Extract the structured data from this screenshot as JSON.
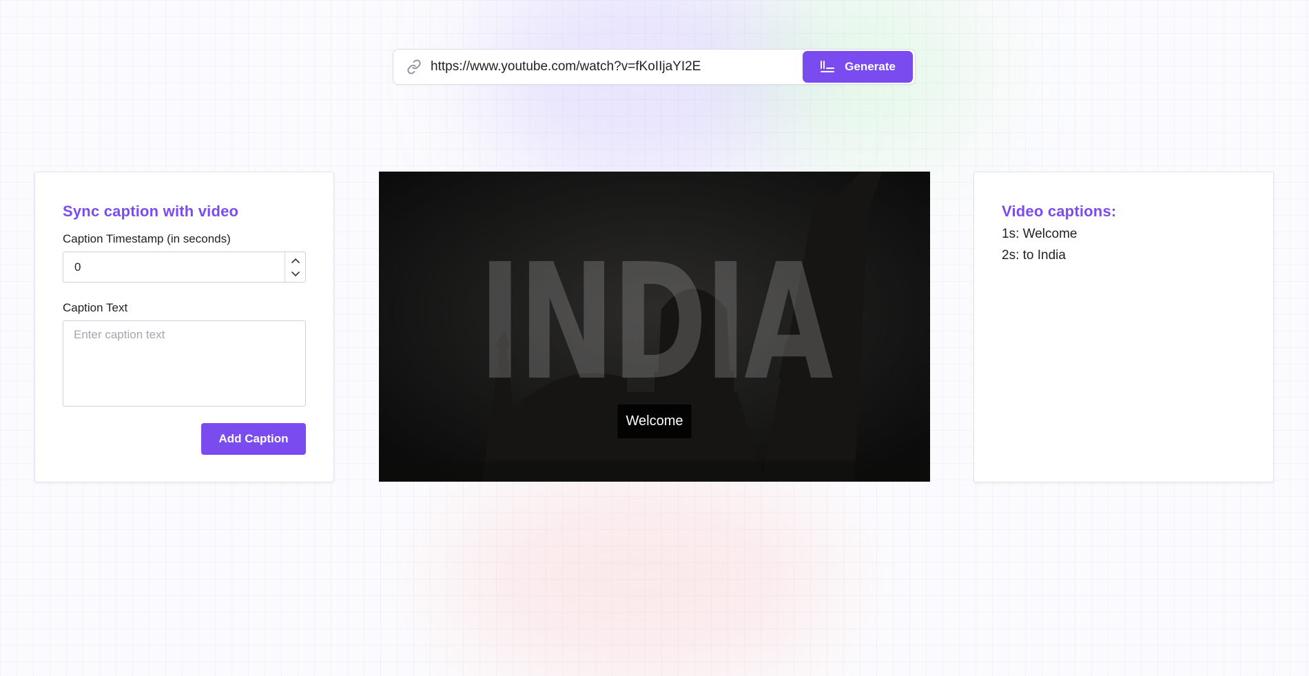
{
  "url_bar": {
    "value": "https://www.youtube.com/watch?v=fKoIIjaYI2E",
    "link_icon": "link-icon",
    "generate_label": "Generate",
    "generate_icon": "align-left-icon"
  },
  "sync_panel": {
    "title": "Sync caption with video",
    "timestamp_label": "Caption Timestamp (in seconds)",
    "timestamp_value": "0",
    "caption_text_label": "Caption Text",
    "caption_text_placeholder": "Enter caption text",
    "add_button_label": "Add Caption"
  },
  "video": {
    "title_text": "INDIA",
    "current_caption": "Welcome"
  },
  "captions_panel": {
    "title": "Video captions:",
    "items": [
      "1s: Welcome",
      "2s: to India"
    ]
  },
  "colors": {
    "accent": "#7a4cf0",
    "video_bg": "#101010"
  }
}
